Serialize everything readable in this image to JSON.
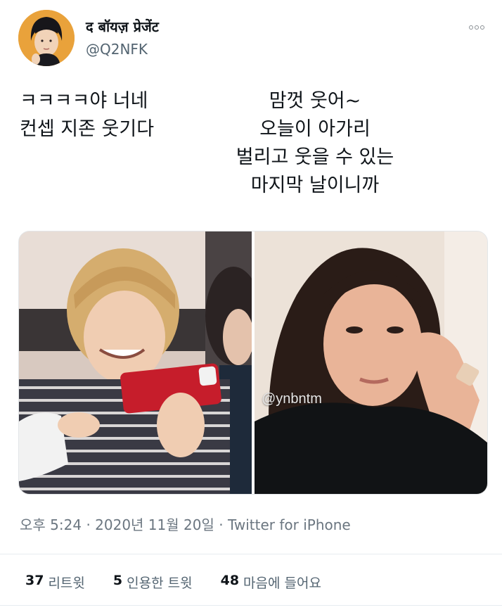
{
  "author": {
    "display_name": "द बॉयज़ प्रेजेंट",
    "handle": "@Q2NFK"
  },
  "tweet": {
    "text_left": [
      "ㅋㅋㅋㅋ야 너네",
      "컨셉 지존 웃기다"
    ],
    "text_right": [
      "맘껏 웃어~",
      "오늘이 아가리",
      "벌리고 웃을 수 있는",
      "마지막 날이니까"
    ],
    "watermark": "@ynbntm"
  },
  "meta": {
    "time": "오후 5:24",
    "separator": "·",
    "date": "2020년 11월 20일",
    "source": "Twitter for iPhone"
  },
  "stats": {
    "retweets_count": "37",
    "retweets_label": "리트윗",
    "quotes_count": "5",
    "quotes_label": "인용한 트윗",
    "likes_count": "48",
    "likes_label": "마음에 들어요"
  },
  "icons": {
    "more": "more-options-icon"
  }
}
